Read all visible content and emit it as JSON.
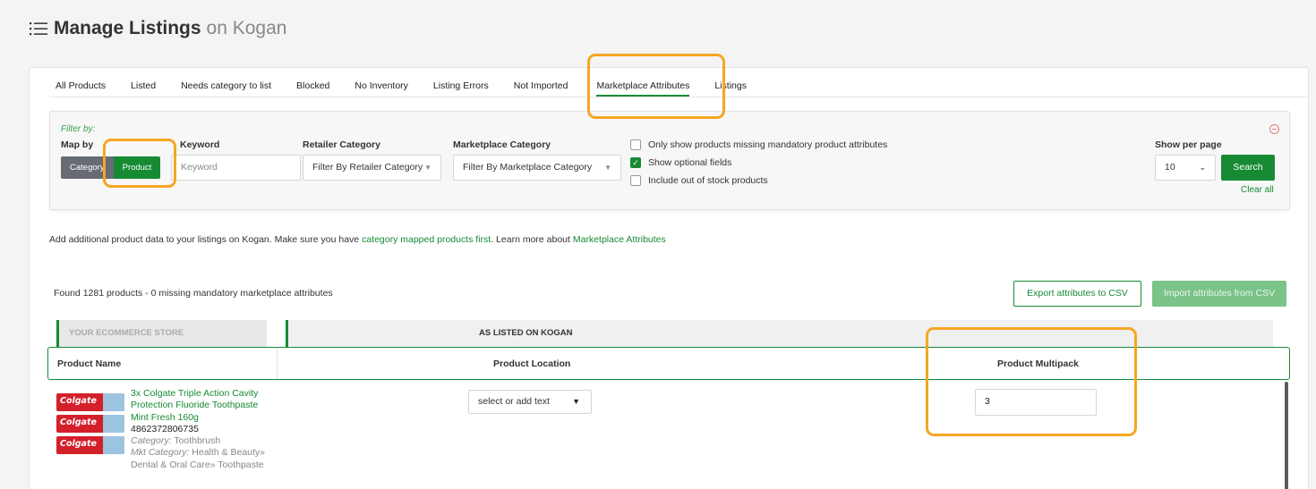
{
  "header": {
    "title": "Manage Listings",
    "subtitle": "on Kogan"
  },
  "tabs": [
    {
      "label": "All Products"
    },
    {
      "label": "Listed"
    },
    {
      "label": "Needs category to list"
    },
    {
      "label": "Blocked"
    },
    {
      "label": "No Inventory"
    },
    {
      "label": "Listing Errors"
    },
    {
      "label": "Not Imported"
    },
    {
      "label": "Marketplace Attributes",
      "active": true
    },
    {
      "label": "Listings"
    }
  ],
  "filter": {
    "title": "Filter by:",
    "map_by_label": "Map by",
    "map_category": "Category",
    "map_product": "Product",
    "keyword_label": "Keyword",
    "keyword_placeholder": "Keyword",
    "retailer_label": "Retailer Category",
    "retailer_value": "Filter By Retailer Category",
    "marketplace_label": "Marketplace Category",
    "marketplace_value": "Filter By Marketplace Category",
    "checkboxes": [
      {
        "label": "Only show products missing mandatory product attributes",
        "checked": false
      },
      {
        "label": "Show optional fields",
        "checked": true
      },
      {
        "label": "Include out of stock products",
        "checked": false
      }
    ],
    "per_page_label": "Show per page",
    "per_page_value": "10",
    "search_label": "Search",
    "clear_label": "Clear all"
  },
  "info": {
    "prefix": "Add additional product data to your listings on Kogan. Make sure you have",
    "link1": "category mapped products first",
    "middle": ". Learn more about",
    "link2": "Marketplace Attributes"
  },
  "results": {
    "found_text": "Found 1281 products - 0 missing mandatory marketplace attributes",
    "export_label": "Export attributes to CSV",
    "import_label": "Import attributes from CSV"
  },
  "table": {
    "store_header": "YOUR ECOMMERCE STORE",
    "kogan_header": "AS LISTED ON KOGAN",
    "columns": [
      "Product Name",
      "Product Location",
      "Product Multipack"
    ],
    "row": {
      "name_lines": [
        "3x Colgate Triple Action Cavity",
        "Protection Fluoride Toothpaste",
        "Mint Fresh 160g"
      ],
      "sku": "4862372806735",
      "category_label": "Category:",
      "category_value": "Toothbrush",
      "mkt_label": "Mkt Category:",
      "mkt_line1": "Health & Beauty»",
      "mkt_line2": "Dental & Oral Care» Toothpaste",
      "location_placeholder": "select or add text",
      "multipack_value": "3",
      "brand_text": "Colgate"
    }
  },
  "colors": {
    "accent": "#178a34",
    "highlight": "#f6a623"
  }
}
